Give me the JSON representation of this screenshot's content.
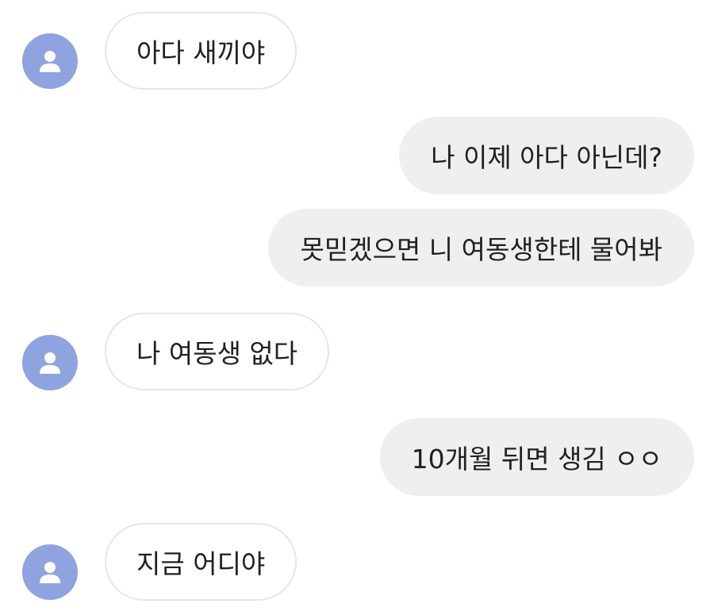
{
  "colors": {
    "avatar_bg": "#8fa3e0",
    "avatar_icon": "#ffffff",
    "incoming_bubble": "#ffffff",
    "incoming_border": "#e6e6e6",
    "outgoing_bubble": "#efefef",
    "text": "#202020"
  },
  "icons": {
    "avatar": "person-icon"
  },
  "messages": [
    {
      "side": "incoming",
      "text": "아다 새끼야"
    },
    {
      "side": "outgoing",
      "text": "나 이제 아다 아닌데?"
    },
    {
      "side": "outgoing",
      "text": "못믿겠으면 니 여동생한테 물어봐"
    },
    {
      "side": "incoming",
      "text": "나 여동생 없다"
    },
    {
      "side": "outgoing",
      "text": "10개월 뒤면 생김 ㅇㅇ"
    },
    {
      "side": "incoming",
      "text": "지금 어디야"
    }
  ]
}
